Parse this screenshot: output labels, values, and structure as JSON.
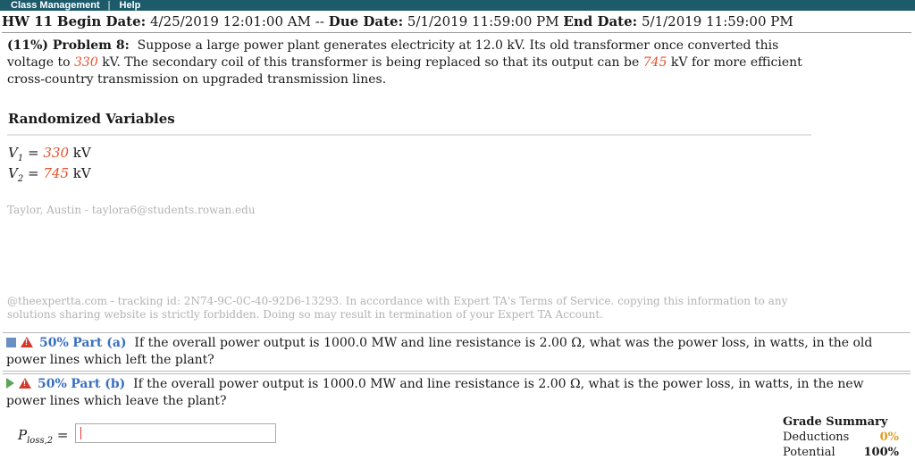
{
  "topbar": {
    "class_management": "Class Management",
    "separator": "|",
    "help": "Help"
  },
  "hw": {
    "title": "HW 11",
    "begin_label": "Begin Date:",
    "begin_value": "4/25/2019 12:01:00 AM",
    "dash": "--",
    "due_label": "Due Date:",
    "due_value": "5/1/2019 11:59:00 PM",
    "end_label": "End Date:",
    "end_value": "5/1/2019 11:59:00 PM"
  },
  "problem": {
    "header": "(11%) Problem 8:",
    "text_1": "Suppose a large power plant generates electricity at 12.0 kV. Its old transformer once converted this voltage to",
    "v1": "330",
    "text_2": "kV. The secondary coil of this transformer is being replaced so that its output can be",
    "v2": "745",
    "text_3": "kV for more efficient cross-country transmission on upgraded transmission lines."
  },
  "randomized": {
    "title": "Randomized Variables",
    "vars": [
      {
        "sym": "V",
        "sub": "1",
        "eq": "=",
        "val": "330",
        "unit": "kV"
      },
      {
        "sym": "V",
        "sub": "2",
        "eq": "=",
        "val": "745",
        "unit": "kV"
      }
    ]
  },
  "user_line": "Taylor, Austin - taylora6@students.rowan.edu",
  "tracking_text": "@theexpertta.com - tracking id: 2N74-9C-0C-40-92D6-13293. In accordance with Expert TA's Terms of Service. copying this information to any solutions sharing website is strictly forbidden. Doing so may result in termination of your Expert TA Account.",
  "parts": [
    {
      "pct": "50%",
      "label": "Part (a)",
      "question": "If the overall power output is 1000.0 MW and line resistance is 2.00 Ω, what was the power loss, in watts, in the old power lines which left the plant?"
    },
    {
      "pct": "50%",
      "label": "Part (b)",
      "question": "If the overall power output is 1000.0 MW and line resistance is 2.00 Ω, what is the power loss, in watts, in the new power lines which leave the plant?"
    }
  ],
  "answer": {
    "sym": "P",
    "sub": "loss,2",
    "eq": "=",
    "value": ""
  },
  "grade_summary": {
    "title": "Grade Summary",
    "deductions_label": "Deductions",
    "deductions_value": "0%",
    "potential_label": "Potential",
    "potential_value": "100%"
  },
  "colors": {
    "topbar": "#1d5b6b",
    "variable_red": "#e8502a",
    "part_label_blue": "#3a6fc0",
    "warning_red": "#d43a2c",
    "deductions_orange": "#e29a1f"
  },
  "icons": [
    "collapse-square-icon",
    "warning-icon",
    "expand-triangle-icon"
  ]
}
